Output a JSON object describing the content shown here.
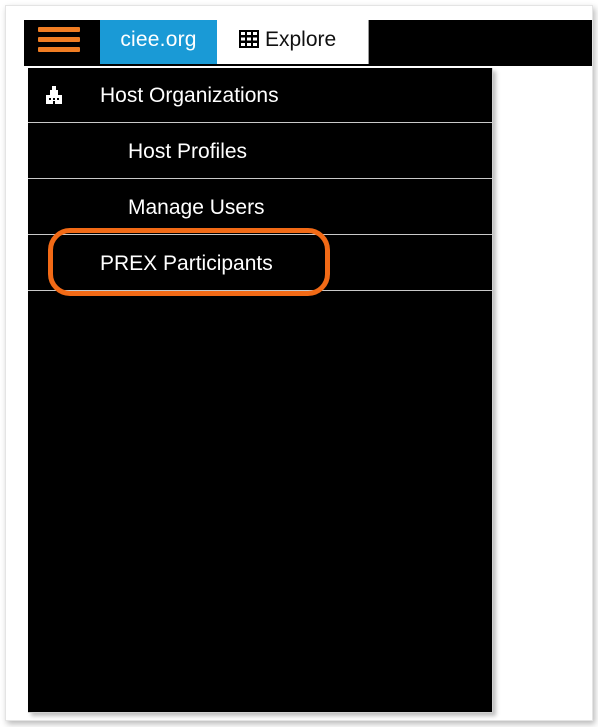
{
  "topbar": {
    "menu_icon": "hamburger-icon",
    "site_tab_label": "ciee.org",
    "explore_label": "Explore",
    "explore_icon": "grid-icon"
  },
  "colors": {
    "accent_orange": "#f07d23",
    "tab_blue": "#1a9ad6",
    "menu_background": "#000000",
    "highlight_orange": "#f26a16"
  },
  "menu": {
    "items": [
      {
        "label": "Host Organizations",
        "icon": "organization-icon"
      },
      {
        "label": "Host Profiles"
      },
      {
        "label": "Manage Users"
      },
      {
        "label": "PREX Participants",
        "highlighted": true
      }
    ]
  }
}
